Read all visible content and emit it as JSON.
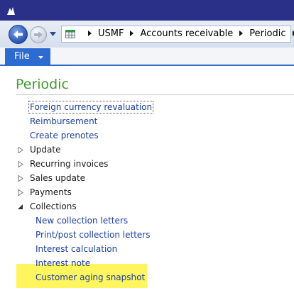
{
  "breadcrumb": [
    "USMF",
    "Accounts receivable",
    "Periodic"
  ],
  "ribbon": {
    "file_label": "File"
  },
  "page": {
    "title": "Periodic"
  },
  "menu": {
    "foreign_currency_revaluation": "Foreign currency revaluation",
    "reimbursement": "Reimbursement",
    "create_prenotes": "Create prenotes",
    "update": "Update",
    "recurring_invoices": "Recurring invoices",
    "sales_update": "Sales update",
    "payments": "Payments",
    "collections": "Collections",
    "collections_children": {
      "new_collection_letters": "New collection letters",
      "print_post_collection_letters": "Print/post collection letters",
      "interest_calculation": "Interest calculation",
      "interest_note": "Interest note",
      "customer_aging_snapshot": "Customer aging snapshot"
    }
  },
  "colors": {
    "title_bar": "#2a2f88",
    "file_tab": "#2d6bd1",
    "page_title": "#3f9b2e",
    "link": "#1a3f9d",
    "highlight": "#fff55e"
  }
}
